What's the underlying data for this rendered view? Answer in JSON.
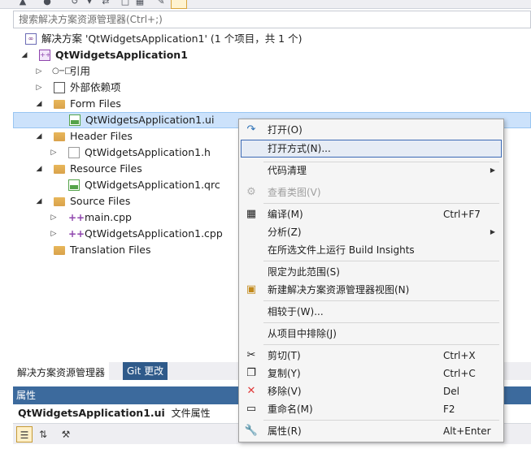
{
  "search": {
    "placeholder": "搜索解决方案资源管理器(Ctrl+;)"
  },
  "tree": {
    "solution_label": "解决方案 'QtWidgetsApplication1' (1 个项目，共 1 个)",
    "project_label": "QtWidgetsApplication1",
    "references_label": "引用",
    "external_deps_label": "外部依赖项",
    "form_files_label": "Form Files",
    "ui_file_label": "QtWidgetsApplication1.ui",
    "header_files_label": "Header Files",
    "header_file_label": "QtWidgetsApplication1.h",
    "resource_files_label": "Resource Files",
    "qrc_file_label": "QtWidgetsApplication1.qrc",
    "source_files_label": "Source Files",
    "main_cpp_label": "main.cpp",
    "app_cpp_label": "QtWidgetsApplication1.cpp",
    "translation_files_label": "Translation Files"
  },
  "tabs": {
    "solution_explorer": "解决方案资源管理器",
    "git_changes": "Git 更改"
  },
  "properties": {
    "header": "属性",
    "object_name": "QtWidgetsApplication1.ui",
    "object_type": "文件属性"
  },
  "context_menu": {
    "open": "打开(O)",
    "open_with": "打开方式(N)...",
    "code_cleanup": "代码清理",
    "view_class_diagram": "查看类图(V)",
    "compile": "编译(M)",
    "compile_shortcut": "Ctrl+F7",
    "analyze": "分析(Z)",
    "run_build_insights": "在所选文件上运行 Build Insights",
    "scope_to_this": "限定为此范围(S)",
    "new_explorer_view": "新建解决方案资源管理器视图(N)",
    "compare_with": "相较于(W)...",
    "exclude_from_project": "从项目中排除(J)",
    "cut": "剪切(T)",
    "cut_shortcut": "Ctrl+X",
    "copy": "复制(Y)",
    "copy_shortcut": "Ctrl+C",
    "remove": "移除(V)",
    "remove_shortcut": "Del",
    "rename": "重命名(M)",
    "rename_shortcut": "F2",
    "properties": "属性(R)",
    "properties_shortcut": "Alt+Enter"
  },
  "colors": {
    "accent_blue": "#3c6a9d",
    "selection": "#cce2fb",
    "menu_highlight_border": "#3c6ab5",
    "remove_red": "#e03a3a"
  }
}
